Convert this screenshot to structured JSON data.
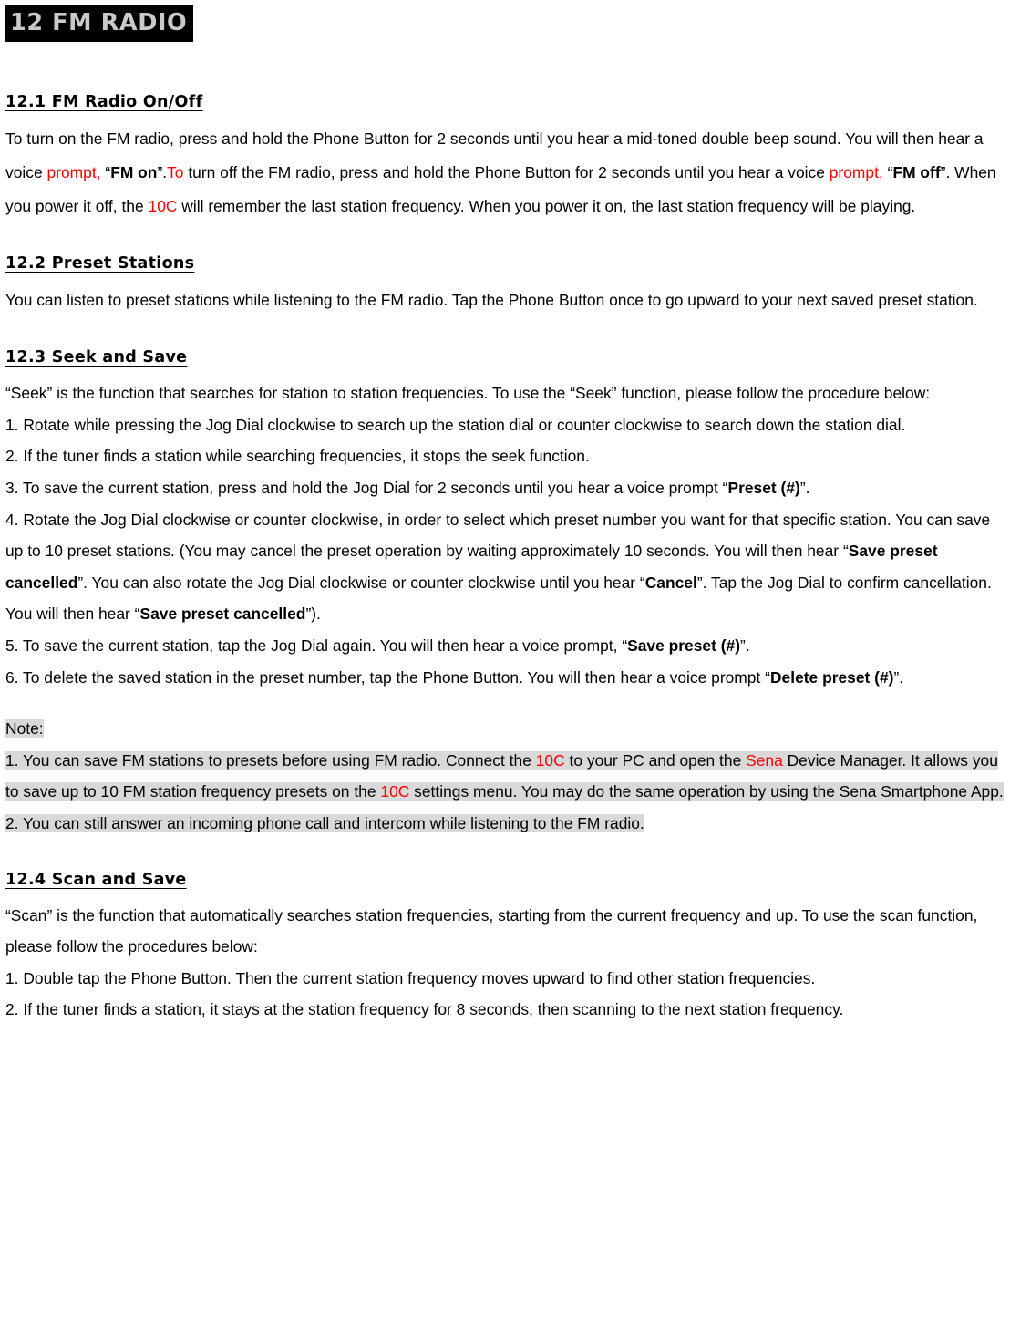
{
  "document": {
    "chapter_title": "12 FM RADIO",
    "colors": {
      "title_background": "#000000",
      "title_text": "#c9c9c9",
      "accent_red": "#ff0000",
      "highlight_gray": "#d9d9d9",
      "body_text": "#000000",
      "page_background": "#ffffff"
    }
  },
  "sections": {
    "s121": {
      "heading": "12.1 FM Radio On/Off",
      "p1": {
        "t1": "To turn on the FM radio, press and hold the Phone Button for 2 seconds until you hear a mid-toned double beep sound. You will then hear a voice ",
        "t2_red": "prompt,",
        "t3": " “",
        "t4_bold": "FM on",
        "t5": "”.",
        "t6_red": "To",
        "t7": " turn off the FM radio, press and hold the Phone Button for 2 seconds until you hear a voice ",
        "t8_red": "prompt,",
        "t9": " “",
        "t10_bold": "FM off",
        "t11": "”. When you power it off, the ",
        "t12_red": "10C",
        "t13": " will remember the last station frequency. When you power it on, the last station frequency will be playing."
      }
    },
    "s122": {
      "heading": "12.2 Preset Stations",
      "p1": "You can listen to preset stations while listening to the FM radio. Tap the Phone Button once to go upward to your next saved preset station."
    },
    "s123": {
      "heading": "12.3 Seek and Save",
      "intro": "“Seek” is the function that searches for station to station frequencies. To use the “Seek” function, please follow the procedure below:",
      "step1": "1. Rotate while pressing the Jog Dial clockwise to search up the station dial or counter clockwise to search down the station dial.",
      "step2": "2. If the tuner finds a station while searching frequencies, it stops the seek function.",
      "step3": {
        "t1": "3. To save the current station, press and hold the Jog Dial for 2 seconds until you hear a voice prompt “",
        "t2_bold": "Preset (#)",
        "t3": "”."
      },
      "step4": {
        "t1": "4. Rotate the Jog Dial clockwise or counter clockwise, in order to select which preset number you want for that specific station. You can save up to 10 preset stations. (You may cancel the preset operation by waiting approximately 10 seconds. You will then hear “",
        "t2_bold": "Save preset cancelled",
        "t3": "”. You can also rotate the Jog Dial clockwise or counter clockwise until you hear “",
        "t4_bold": "Cancel",
        "t5": "”. Tap the Jog Dial to confirm cancellation. You will then hear “",
        "t6_bold": "Save preset cancelled",
        "t7": "”)."
      },
      "step5": {
        "t1": "5. To save the current station, tap the Jog Dial again. You will then hear a voice prompt, “",
        "t2_bold": "Save preset (#)",
        "t3": "”."
      },
      "step6": {
        "t1": "6. To delete the saved station in the preset number, tap the Phone Button. You will then hear a voice prompt “",
        "t2_bold": "Delete preset (#)",
        "t3": "”."
      },
      "note": {
        "label": "Note:",
        "n1": {
          "t1": "1. You can save FM stations to presets before using FM radio. Connect the ",
          "t2_red": "10C",
          "t3": " to your PC and open the ",
          "t4_red": "Sena",
          "t5": " Device Manager. It allows you to save up to 10 FM station frequency presets on the ",
          "t6_red": "10C",
          "t7": " settings menu. You may do the same operation by using the Sena Smartphone App. "
        },
        "n2": "2. You can still answer an incoming phone call and intercom while listening to the FM radio. "
      }
    },
    "s124": {
      "heading": "12.4 Scan and Save",
      "intro": "“Scan” is the function that automatically searches station frequencies, starting from the current frequency and up. To use the scan function, please follow the procedures below:",
      "step1": "1. Double tap the Phone Button. Then the current station frequency moves upward to find other station frequencies.",
      "step2": "2. If the tuner finds a station, it stays at the station frequency for 8 seconds, then scanning to the next station frequency."
    }
  }
}
